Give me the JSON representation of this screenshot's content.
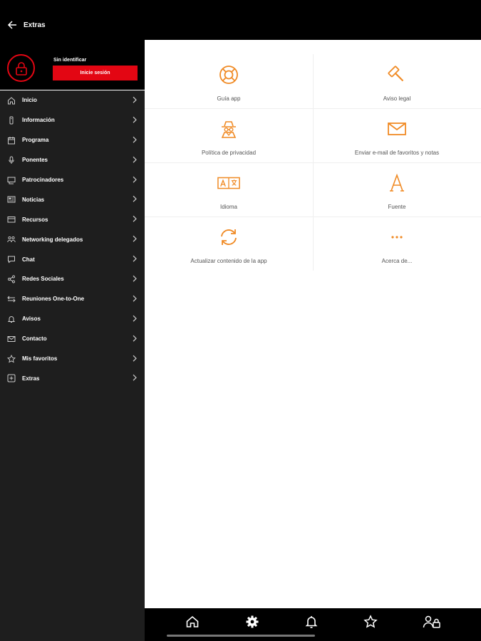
{
  "header": {
    "title": "Extras",
    "back_icon": "arrow-left-icon"
  },
  "user": {
    "status": "Sin identificar",
    "login_label": "Inicie sesión",
    "avatar_icon": "lock-icon"
  },
  "sidebar": {
    "items": [
      {
        "label": "Inicio",
        "icon": "home-icon"
      },
      {
        "label": "Información",
        "icon": "info-icon"
      },
      {
        "label": "Programa",
        "icon": "calendar-icon"
      },
      {
        "label": "Ponentes",
        "icon": "microphone-icon"
      },
      {
        "label": "Patrocinadores",
        "icon": "sponsors-icon"
      },
      {
        "label": "Noticias",
        "icon": "news-icon"
      },
      {
        "label": "Recursos",
        "icon": "resources-icon"
      },
      {
        "label": "Networking delegados",
        "icon": "networking-icon"
      },
      {
        "label": "Chat",
        "icon": "chat-icon"
      },
      {
        "label": "Redes Sociales",
        "icon": "share-icon"
      },
      {
        "label": "Reuniones One-to-One",
        "icon": "meetings-icon"
      },
      {
        "label": "Avisos",
        "icon": "bell-icon"
      },
      {
        "label": "Contacto",
        "icon": "mail-icon"
      },
      {
        "label": "Mis favoritos",
        "icon": "star-icon"
      },
      {
        "label": "Extras",
        "icon": "plus-square-icon"
      }
    ]
  },
  "grid": {
    "tiles": [
      {
        "label": "Guía app",
        "icon": "lifebuoy-icon"
      },
      {
        "label": "Aviso legal",
        "icon": "gavel-icon"
      },
      {
        "label": "Política de privacidad",
        "icon": "spy-icon"
      },
      {
        "label": "Enviar e-mail de favoritos y notas",
        "icon": "envelope-icon"
      },
      {
        "label": "Idioma",
        "icon": "language-icon"
      },
      {
        "label": "Fuente",
        "icon": "font-icon"
      },
      {
        "label": "Actualizar contenido de la app",
        "icon": "refresh-icon"
      },
      {
        "label": "Acerca de...",
        "icon": "more-dots-icon"
      }
    ]
  },
  "bottom_nav": {
    "items": [
      {
        "icon": "home-icon"
      },
      {
        "icon": "gear-icon"
      },
      {
        "icon": "bell-icon"
      },
      {
        "icon": "star-icon"
      },
      {
        "icon": "user-lock-icon"
      }
    ]
  },
  "colors": {
    "accent": "#e30613",
    "icon_orange": "#f08a24",
    "sidebar_bg": "#1e1e1e"
  }
}
